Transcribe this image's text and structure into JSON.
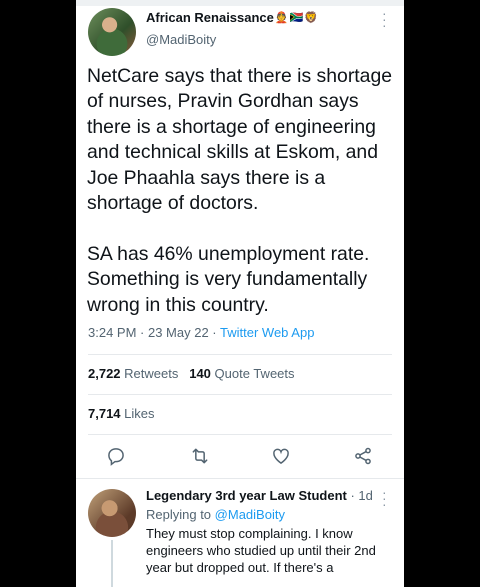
{
  "tweet": {
    "author_name": "African Renaissance",
    "author_emojis": [
      "👲",
      "🇿🇦",
      "🦁"
    ],
    "handle": "@MadiBoity",
    "text": "NetCare says that there is shortage of nurses, Pravin Gordhan says there is a shortage of engineering and technical skills at Eskom, and Joe Phaahla says there is a shortage of doctors.\n\nSA has 46% unemployment rate. Something is very fundamentally wrong in this country.",
    "time": "3:24 PM",
    "date": "23 May 22",
    "app": "Twitter Web App",
    "retweets_count": "2,722",
    "retweets_label": "Retweets",
    "quotes_count": "140",
    "quotes_label": "Quote Tweets",
    "likes_count": "7,714",
    "likes_label": "Likes"
  },
  "actions": {
    "icons": [
      "reply-icon",
      "retweet-icon",
      "like-icon",
      "share-icon"
    ]
  },
  "reply": {
    "author_name": "Legendary 3rd year Law Student",
    "time": "1d",
    "replying_to_label": "Replying to",
    "replying_to_handle": "@MadiBoity",
    "text": "They must stop complaining. I know engineers who studied up until their 2nd year but dropped out. If there's a"
  },
  "colors": {
    "link": "#1d9bf0",
    "text": "#0f1419",
    "secondary": "#536471",
    "background": "#000000"
  }
}
